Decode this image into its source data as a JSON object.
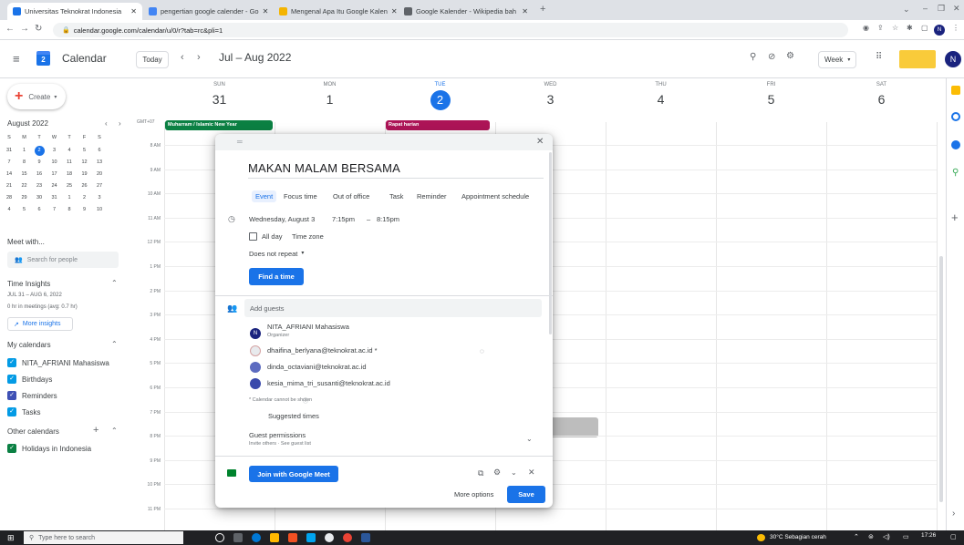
{
  "browser": {
    "tabs": [
      {
        "title": "Universitas Teknokrat Indonesia",
        "color": "#1a73e8",
        "active": true
      },
      {
        "title": "pengertian google calender - Go",
        "color": "#4285f4",
        "active": false
      },
      {
        "title": "Mengenal Apa Itu Google Kalen",
        "color": "#f4b400",
        "active": false
      },
      {
        "title": "Google Kalender - Wikipedia bah",
        "color": "#5f6368",
        "active": false
      }
    ],
    "new_tab": "+",
    "url": "calendar.google.com/calendar/u/0/r?tab=rc&pli=1",
    "profile_initial": "N"
  },
  "header": {
    "app_name": "Calendar",
    "app_icon_day": "2",
    "today_label": "Today",
    "range_label": "Jul – Aug 2022",
    "view_label": "Week",
    "profile_initial": "N"
  },
  "sidebar": {
    "create_label": "Create",
    "mini_month_title": "August 2022",
    "mini_weekdays": [
      "S",
      "M",
      "T",
      "W",
      "T",
      "F",
      "S"
    ],
    "mini_weeks": [
      [
        "31",
        "1",
        "2",
        "3",
        "4",
        "5",
        "6"
      ],
      [
        "7",
        "8",
        "9",
        "10",
        "11",
        "12",
        "13"
      ],
      [
        "14",
        "15",
        "16",
        "17",
        "18",
        "19",
        "20"
      ],
      [
        "21",
        "22",
        "23",
        "24",
        "25",
        "26",
        "27"
      ],
      [
        "28",
        "29",
        "30",
        "31",
        "1",
        "2",
        "3"
      ],
      [
        "4",
        "5",
        "6",
        "7",
        "8",
        "9",
        "10"
      ]
    ],
    "meet_label": "Meet with...",
    "search_people": "Search for people",
    "insights_title": "Time Insights",
    "insights_range": "JUL 31 – AUG 6, 2022",
    "insights_summary": "0 hr in meetings (avg: 0.7 hr)",
    "more_insights": "More insights",
    "my_calendars_title": "My calendars",
    "my_calendars": [
      {
        "name": "NITA_AFRIANI Mahasiswa",
        "color": "#039be5"
      },
      {
        "name": "Birthdays",
        "color": "#039be5"
      },
      {
        "name": "Reminders",
        "color": "#3f51b5"
      },
      {
        "name": "Tasks",
        "color": "#039be5"
      }
    ],
    "other_calendars_title": "Other calendars",
    "other_calendars": [
      {
        "name": "Holidays in Indonesia",
        "color": "#0b8043"
      }
    ]
  },
  "grid": {
    "timezone": "GMT+07",
    "days": [
      {
        "name": "SUN",
        "num": "31"
      },
      {
        "name": "MON",
        "num": "1"
      },
      {
        "name": "TUE",
        "num": "2"
      },
      {
        "name": "WED",
        "num": "3"
      },
      {
        "name": "THU",
        "num": "4"
      },
      {
        "name": "FRI",
        "num": "5"
      },
      {
        "name": "SAT",
        "num": "6"
      }
    ],
    "times": [
      "8 AM",
      "9 AM",
      "10 AM",
      "11 AM",
      "12 PM",
      "1 PM",
      "2 PM",
      "3 PM",
      "4 PM",
      "5 PM",
      "6 PM",
      "7 PM",
      "8 PM",
      "9 PM",
      "10 PM",
      "11 PM"
    ],
    "allday_events": [
      {
        "title": "Muharram / Islamic New Year",
        "color": "#0b8043"
      },
      {
        "title": "Rapat harian",
        "color": "#ad1457"
      }
    ]
  },
  "dialog": {
    "title": "MAKAN MALAM BERSAMA",
    "types": [
      "Event",
      "Focus time",
      "Out of office",
      "Task",
      "Reminder",
      "Appointment schedule"
    ],
    "date": "Wednesday, August 3",
    "start": "7:15pm",
    "dash": "–",
    "end": "8:15pm",
    "allday": "All day",
    "timezone": "Time zone",
    "repeat": "Does not repeat",
    "find_time": "Find a time",
    "add_guests": "Add guests",
    "organizer": {
      "name": "NITA_AFRIANI Mahasiswa",
      "role": "Organizer",
      "initial": "N"
    },
    "guests": [
      {
        "email": "dhaifina_berlyana@teknokrat.ac.id *"
      },
      {
        "email": "dinda_octaviani@teknokrat.ac.id"
      },
      {
        "email": "kesia_mima_tri_susanti@teknokrat.ac.id"
      }
    ],
    "calendar_note": "* Calendar cannot be shown",
    "suggested_times": "Suggested times",
    "permissions_title": "Guest permissions",
    "permissions_sub": "Invite others · See guest list",
    "meet_button": "Join with Google Meet",
    "more_options": "More options",
    "save": "Save"
  },
  "taskbar": {
    "search": "Type here to search",
    "weather": "30°C  Sebagian cerah",
    "time": "17:26"
  }
}
